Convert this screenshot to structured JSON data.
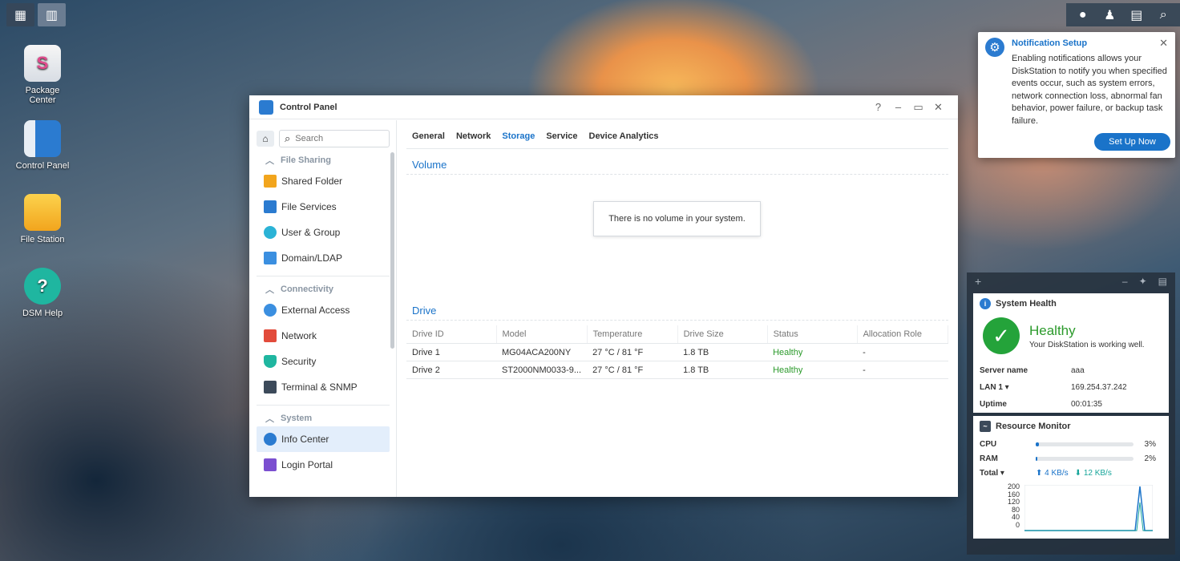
{
  "desktop": {
    "icons": [
      {
        "label": "Package\nCenter",
        "label_l1": "Package",
        "label_l2": "Center"
      },
      {
        "label": "Control Panel"
      },
      {
        "label": "File Station"
      },
      {
        "label": "DSM Help"
      }
    ]
  },
  "taskbar": {
    "left": [
      {
        "icon": "grid-icon"
      },
      {
        "icon": "control-panel-icon"
      }
    ],
    "right": [
      {
        "icon": "chat-icon"
      },
      {
        "icon": "user-icon"
      },
      {
        "icon": "widgets-icon"
      },
      {
        "icon": "search-icon"
      }
    ]
  },
  "control_panel": {
    "title": "Control Panel",
    "search_placeholder": "Search",
    "sections": [
      {
        "title": "File Sharing",
        "items": [
          "Shared Folder",
          "File Services",
          "User & Group",
          "Domain/LDAP"
        ]
      },
      {
        "title": "Connectivity",
        "items": [
          "External Access",
          "Network",
          "Security",
          "Terminal & SNMP"
        ]
      },
      {
        "title": "System",
        "items": [
          "Info Center",
          "Login Portal"
        ]
      }
    ],
    "active_item": "Info Center",
    "tabs": [
      "General",
      "Network",
      "Storage",
      "Service",
      "Device Analytics"
    ],
    "active_tab": "Storage",
    "volume_title": "Volume",
    "no_volume": "There is no volume in your system.",
    "drive_title": "Drive",
    "columns": [
      "Drive ID",
      "Model",
      "Temperature",
      "Drive Size",
      "Status",
      "Allocation Role"
    ],
    "drives": [
      {
        "id": "Drive 1",
        "model": "MG04ACA200NY",
        "temp": "27 °C / 81 °F",
        "size": "1.8 TB",
        "status": "Healthy",
        "role": "-"
      },
      {
        "id": "Drive 2",
        "model": "ST2000NM0033-9...",
        "temp": "27 °C / 81 °F",
        "size": "1.8 TB",
        "status": "Healthy",
        "role": "-"
      }
    ]
  },
  "notification": {
    "title": "Notification Setup",
    "body": "Enabling notifications allows your DiskStation to notify you when specified events occur, such as system errors, network connection loss, abnormal fan behavior, power failure, or backup task failure.",
    "button": "Set Up Now"
  },
  "widgets": {
    "system_health": {
      "title": "System Health",
      "status": "Healthy",
      "message": "Your DiskStation is working well.",
      "server_name_label": "Server name",
      "server_name": "aaa",
      "lan_label": "LAN 1 ▾",
      "lan_ip": "169.254.37.242",
      "uptime_label": "Uptime",
      "uptime": "00:01:35"
    },
    "resource_monitor": {
      "title": "Resource Monitor",
      "cpu_label": "CPU",
      "cpu_pct": "3%",
      "cpu_value": 3,
      "ram_label": "RAM",
      "ram_pct": "2%",
      "ram_value": 2,
      "total_label": "Total ▾",
      "upload": "4 KB/s",
      "download": "12 KB/s",
      "y_ticks": [
        "200",
        "160",
        "120",
        "80",
        "40",
        "0"
      ]
    }
  },
  "colors": {
    "accent": "#1a73c9",
    "healthy": "#2b9a2b"
  }
}
